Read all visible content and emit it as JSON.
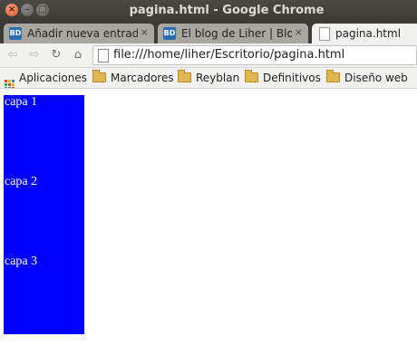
{
  "window": {
    "title": "pagina.html - Google Chrome"
  },
  "tabs": [
    {
      "label": "Añadir nueva entrada",
      "favicon": "BD",
      "close": "×",
      "active": false
    },
    {
      "label": "El blog de Liher | Blog",
      "favicon": "BD",
      "close": "×",
      "active": false
    },
    {
      "label": "pagina.html",
      "favicon": "",
      "close": "",
      "active": true
    }
  ],
  "toolbar": {
    "url": "file:///home/liher/Escritorio/pagina.html"
  },
  "bookmarks": [
    {
      "label": "Aplicaciones",
      "icon": "apps-icon"
    },
    {
      "label": "Marcadores",
      "icon": "folder-icon"
    },
    {
      "label": "Reyblan",
      "icon": "folder-icon"
    },
    {
      "label": "Definitivos",
      "icon": "folder-icon"
    },
    {
      "label": "Diseño web",
      "icon": "folder-icon"
    }
  ],
  "page": {
    "layers": [
      "capa 1",
      "capa 2",
      "capa 3"
    ],
    "layer_color": "#0000ff",
    "text_color": "#ffffff"
  }
}
